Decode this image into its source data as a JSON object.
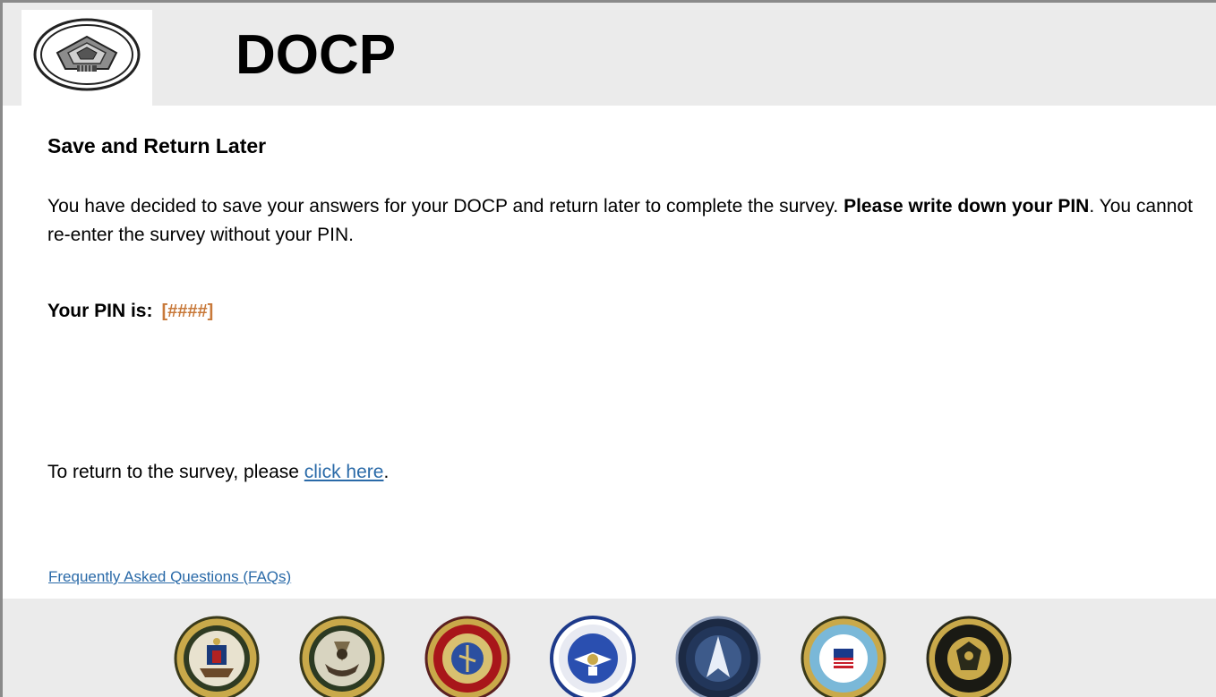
{
  "header": {
    "app_title": "DOCP",
    "logo_icon": "pentagon-logo-icon"
  },
  "main": {
    "heading": "Save and Return Later",
    "message_part1": "You have decided to save your answers for your DOCP and return later to complete the survey. ",
    "message_bold": "Please write down your PIN",
    "message_part2": ". You cannot re-enter the survey without your PIN.",
    "pin_label": "Your PIN is:",
    "pin_value": "[####]",
    "return_prefix": "To return to the survey, please ",
    "return_link": "click here",
    "return_suffix": "."
  },
  "footer_links": {
    "faq": "Frequently Asked Questions (FAQs)"
  },
  "footer": {
    "seals": [
      {
        "name": "army-seal-icon"
      },
      {
        "name": "navy-seal-icon"
      },
      {
        "name": "marine-corps-seal-icon"
      },
      {
        "name": "air-force-seal-icon"
      },
      {
        "name": "space-force-seal-icon"
      },
      {
        "name": "coast-guard-seal-icon"
      },
      {
        "name": "national-guard-seal-icon"
      }
    ]
  },
  "colors": {
    "header_bg": "#ebebeb",
    "link": "#2a6aa8",
    "pin_value": "#c8793a"
  }
}
